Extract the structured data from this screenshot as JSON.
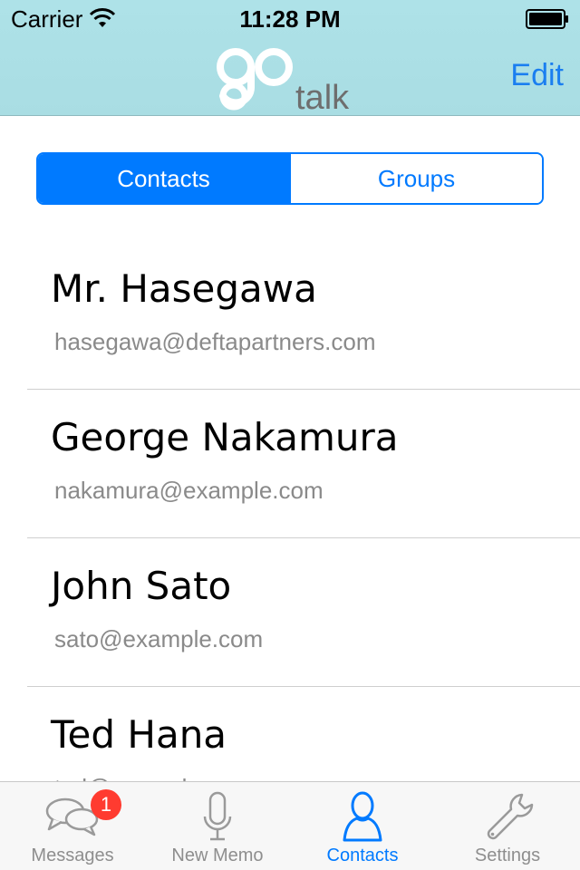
{
  "status_bar": {
    "carrier": "Carrier",
    "time": "11:28 PM"
  },
  "header": {
    "logo_text": "go talk",
    "edit_label": "Edit"
  },
  "segments": {
    "contacts_label": "Contacts",
    "groups_label": "Groups",
    "selected": "Contacts"
  },
  "contacts": [
    {
      "name": "Mr. Hasegawa",
      "email": "hasegawa@deftapartners.com"
    },
    {
      "name": "George Nakamura",
      "email": "nakamura@example.com"
    },
    {
      "name": "John Sato",
      "email": "sato@example.com"
    },
    {
      "name": "Ted Hana",
      "email": "ted@example.com"
    }
  ],
  "tab_bar": {
    "messages_label": "Messages",
    "messages_badge": "1",
    "new_memo_label": "New Memo",
    "contacts_label": "Contacts",
    "settings_label": "Settings",
    "active_tab": "Contacts"
  },
  "colors": {
    "accent": "#007aff",
    "header_bg": "#aee2e8",
    "badge": "#ff3b30",
    "logo_gray": "#6e6e6e"
  },
  "icons": {
    "wifi": "wifi-icon",
    "battery": "battery-icon",
    "messages": "chat-bubbles-icon",
    "new_memo": "microphone-icon",
    "contacts": "person-icon",
    "settings": "wrench-icon"
  }
}
